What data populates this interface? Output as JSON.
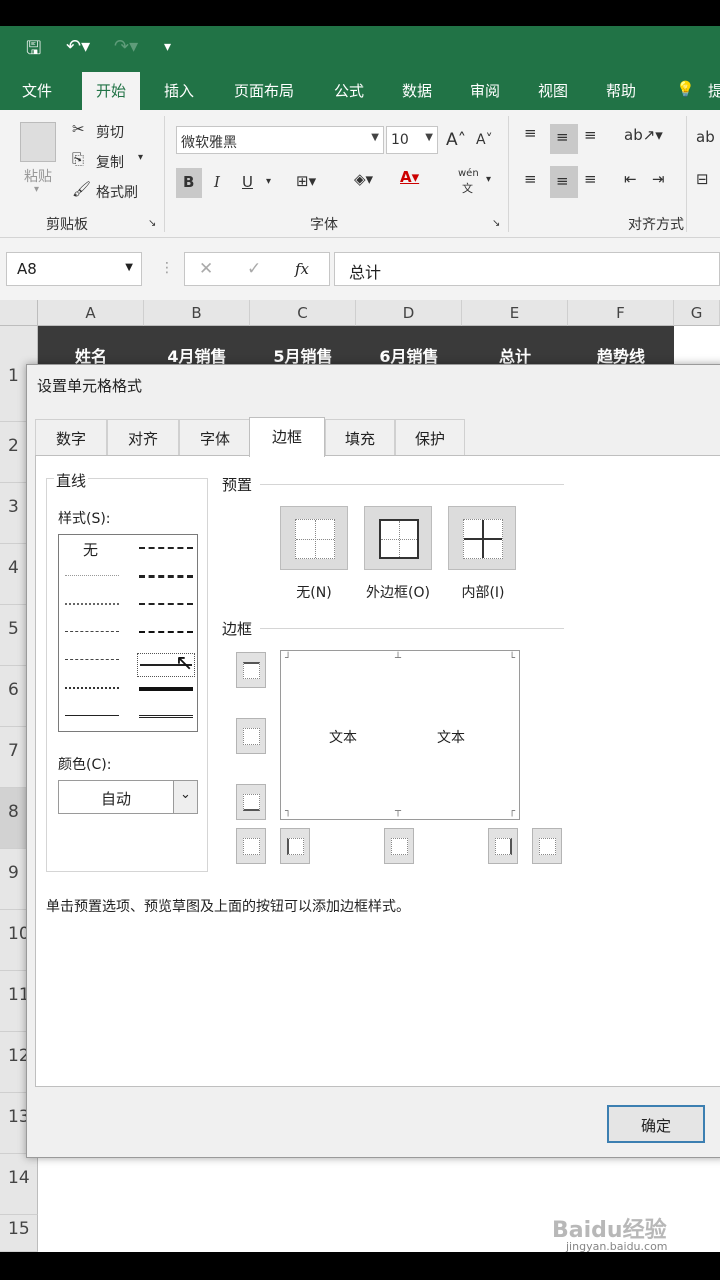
{
  "ribbon_tabs": [
    "文件",
    "开始",
    "插入",
    "页面布局",
    "公式",
    "数据",
    "审阅",
    "视图",
    "帮助",
    "提"
  ],
  "clipboard": {
    "paste": "粘贴",
    "cut": "剪切",
    "copy": "复制",
    "format_painter": "格式刷",
    "group": "剪贴板"
  },
  "font": {
    "name": "微软雅黑",
    "size": "10",
    "bold": "B",
    "italic": "I",
    "underline": "U",
    "wen": "wén",
    "wen_char": "文",
    "group": "字体"
  },
  "align_group": "对齐方式",
  "formula_bar": {
    "name_box": "A8",
    "content": "总计",
    "fx": "fx"
  },
  "sheet": {
    "columns": [
      "A",
      "B",
      "C",
      "D",
      "E",
      "F",
      "G"
    ],
    "header_row": [
      "姓名",
      "4月销售",
      "5月销售",
      "6月销售",
      "总计",
      "趋势线"
    ],
    "rows": [
      "1",
      "2",
      "3",
      "4",
      "5",
      "6",
      "7",
      "8",
      "9",
      "10",
      "11",
      "12",
      "13",
      "14",
      "15"
    ]
  },
  "dialog": {
    "title": "设置单元格格式",
    "tabs": [
      "数字",
      "对齐",
      "字体",
      "边框",
      "填充",
      "保护"
    ],
    "line_group": "直线",
    "style_label": "样式(S):",
    "style_none": "无",
    "color_label": "颜色(C):",
    "color_value": "自动",
    "preset_group": "预置",
    "presets": [
      "无(N)",
      "外边框(O)",
      "内部(I)"
    ],
    "border_group": "边框",
    "preview_text": [
      "文本",
      "文本"
    ],
    "hint": "单击预置选项、预览草图及上面的按钮可以添加边框样式。",
    "ok": "确定"
  },
  "watermark": {
    "logo": "Baidu经验",
    "url": "jingyan.baidu.com"
  },
  "colors": {
    "excel_green": "#217346",
    "header_dark": "#3a3a3a",
    "ok_border": "#3c7fb1"
  }
}
